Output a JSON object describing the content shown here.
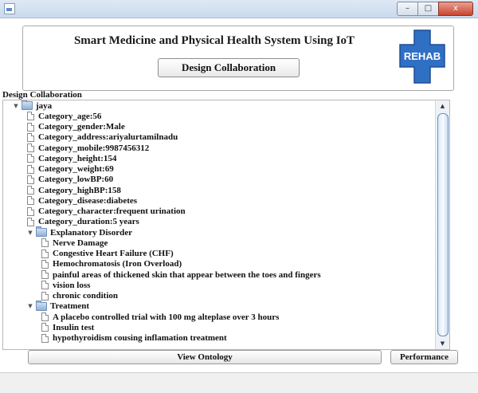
{
  "window": {
    "minimize_glyph": "–",
    "maximize_glyph": "□",
    "close_glyph": "x"
  },
  "header": {
    "title": "Smart Medicine and Physical Health System Using IoT",
    "design_button_label": "Design Collaboration",
    "logo_text": "REHAB",
    "logo_color": "#2f6fc4"
  },
  "section_label": "Design Collaboration",
  "tree": [
    {
      "label": "jaya",
      "type": "folder",
      "depth": 0,
      "expanded": true
    },
    {
      "label": "Category_age:56",
      "type": "leaf",
      "depth": 1
    },
    {
      "label": "Category_gender:Male",
      "type": "leaf",
      "depth": 1
    },
    {
      "label": "Category_address:ariyalurtamilnadu",
      "type": "leaf",
      "depth": 1
    },
    {
      "label": "Category_mobile:9987456312",
      "type": "leaf",
      "depth": 1
    },
    {
      "label": "Category_height:154",
      "type": "leaf",
      "depth": 1
    },
    {
      "label": "Category_weight:69",
      "type": "leaf",
      "depth": 1
    },
    {
      "label": "Category_lowBP:60",
      "type": "leaf",
      "depth": 1
    },
    {
      "label": "Category_highBP:158",
      "type": "leaf",
      "depth": 1
    },
    {
      "label": "Category_disease:diabetes",
      "type": "leaf",
      "depth": 1
    },
    {
      "label": "Category_character:frequent urination",
      "type": "leaf",
      "depth": 1
    },
    {
      "label": "Category_duration:5 years",
      "type": "leaf",
      "depth": 1
    },
    {
      "label": "Explanatory Disorder",
      "type": "folder",
      "depth": 1,
      "expanded": true
    },
    {
      "label": "Nerve Damage",
      "type": "leaf",
      "depth": 2
    },
    {
      "label": "Congestive Heart Failure (CHF)",
      "type": "leaf",
      "depth": 2
    },
    {
      "label": "Hemochromatosis (Iron Overload)",
      "type": "leaf",
      "depth": 2
    },
    {
      "label": "painful areas of thickened skin that appear between the toes and fingers",
      "type": "leaf",
      "depth": 2
    },
    {
      "label": "vision loss",
      "type": "leaf",
      "depth": 2
    },
    {
      "label": "chronic condition",
      "type": "leaf",
      "depth": 2
    },
    {
      "label": "Treatment",
      "type": "folder",
      "depth": 1,
      "expanded": true
    },
    {
      "label": "A placebo controlled trial with 100 mg alteplase over 3 hours",
      "type": "leaf",
      "depth": 2
    },
    {
      "label": "Insulin test",
      "type": "leaf",
      "depth": 2
    },
    {
      "label": "hypothyroidism cousing inflamation treatment",
      "type": "leaf",
      "depth": 2
    }
  ],
  "scroll": {
    "up_glyph": "▲",
    "down_glyph": "▼"
  },
  "buttons": {
    "view_ontology": "View Ontology",
    "performance": "Performance"
  }
}
